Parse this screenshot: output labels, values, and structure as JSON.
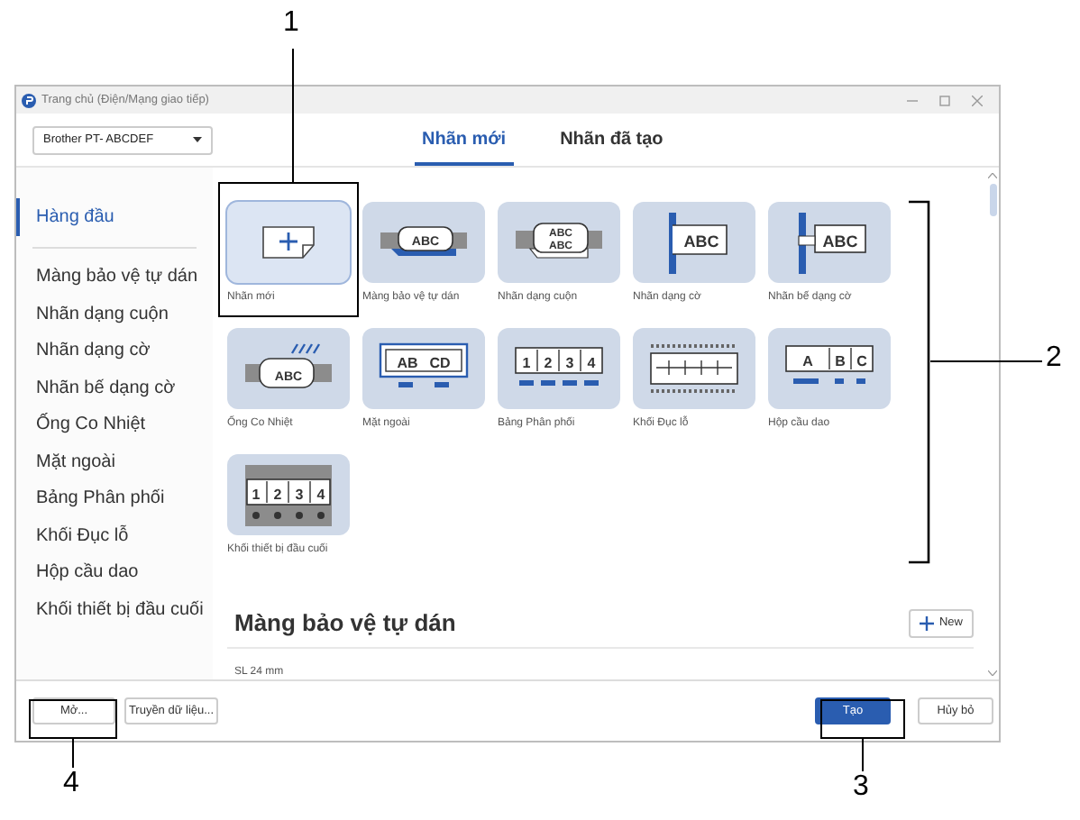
{
  "window": {
    "title": "Trang chủ (Điện/Mạng giao tiếp)"
  },
  "printer_dropdown": {
    "value": "Brother PT- ABCDEF"
  },
  "tabs": [
    {
      "label": "Nhãn mới",
      "selected": true
    },
    {
      "label": "Nhãn đã tạo",
      "selected": false
    }
  ],
  "sidebar": {
    "items": [
      {
        "label": "Hàng đầu",
        "selected": true
      },
      {
        "label": "Màng bảo vệ tự dán",
        "selected": false
      },
      {
        "label": "Nhãn dạng cuộn",
        "selected": false
      },
      {
        "label": "Nhãn dạng cờ",
        "selected": false
      },
      {
        "label": "Nhãn bế dạng cờ",
        "selected": false
      },
      {
        "label": "Ống Co Nhiệt",
        "selected": false
      },
      {
        "label": "Mặt ngoài",
        "selected": false
      },
      {
        "label": "Bảng Phân phối",
        "selected": false
      },
      {
        "label": "Khối Đục lỗ",
        "selected": false
      },
      {
        "label": "Hộp cầu dao",
        "selected": false
      },
      {
        "label": "Khối thiết bị đầu cuối",
        "selected": false
      }
    ]
  },
  "tiles": [
    {
      "kind": "new",
      "label": "Nhãn mới",
      "selected": true
    },
    {
      "kind": "laminated",
      "label": "Màng bảo vệ tự dán",
      "selected": false,
      "art_text": [
        "ABC"
      ]
    },
    {
      "kind": "wrap",
      "label": "Nhãn dạng cuộn",
      "selected": false,
      "art_text": [
        "ABC",
        "ABC"
      ]
    },
    {
      "kind": "flag",
      "label": "Nhãn dạng cờ",
      "selected": false,
      "art_text": [
        "ABC"
      ]
    },
    {
      "kind": "punch_flag",
      "label": "Nhãn bế dạng cờ",
      "selected": false,
      "art_text": [
        "ABC"
      ]
    },
    {
      "kind": "heat_shrink",
      "label": "Ống Co Nhiệt",
      "selected": false,
      "art_text": [
        "ABC"
      ]
    },
    {
      "kind": "faceplate",
      "label": "Mặt ngoài",
      "selected": false,
      "art_text": [
        "AB",
        "CD"
      ]
    },
    {
      "kind": "patch_panel",
      "label": "Bảng Phân phối",
      "selected": false,
      "art_text": [
        "1",
        "2",
        "3",
        "4"
      ]
    },
    {
      "kind": "punchdown",
      "label": "Khối Đục lỗ",
      "selected": false
    },
    {
      "kind": "breaker",
      "label": "Hộp cầu dao",
      "selected": false,
      "art_text": [
        "A",
        "B",
        "C"
      ]
    },
    {
      "kind": "terminal",
      "label": "Khối thiết bị đầu cuối",
      "selected": false,
      "art_text": [
        "1",
        "2",
        "3",
        "4"
      ]
    }
  ],
  "section": {
    "title": "Màng bảo vệ tự dán",
    "new_button": "New",
    "size_label": "SL 24 mm"
  },
  "footer": {
    "buttons": [
      {
        "label": "Mở...",
        "kind": "secondary"
      },
      {
        "label": "Truyền dữ liệu...",
        "kind": "secondary"
      },
      {
        "label": "Tạo",
        "kind": "primary"
      },
      {
        "label": "Hủy bỏ",
        "kind": "secondary"
      }
    ]
  },
  "callouts": [
    {
      "number": "1"
    },
    {
      "number": "2"
    },
    {
      "number": "3"
    },
    {
      "number": "4"
    }
  ]
}
